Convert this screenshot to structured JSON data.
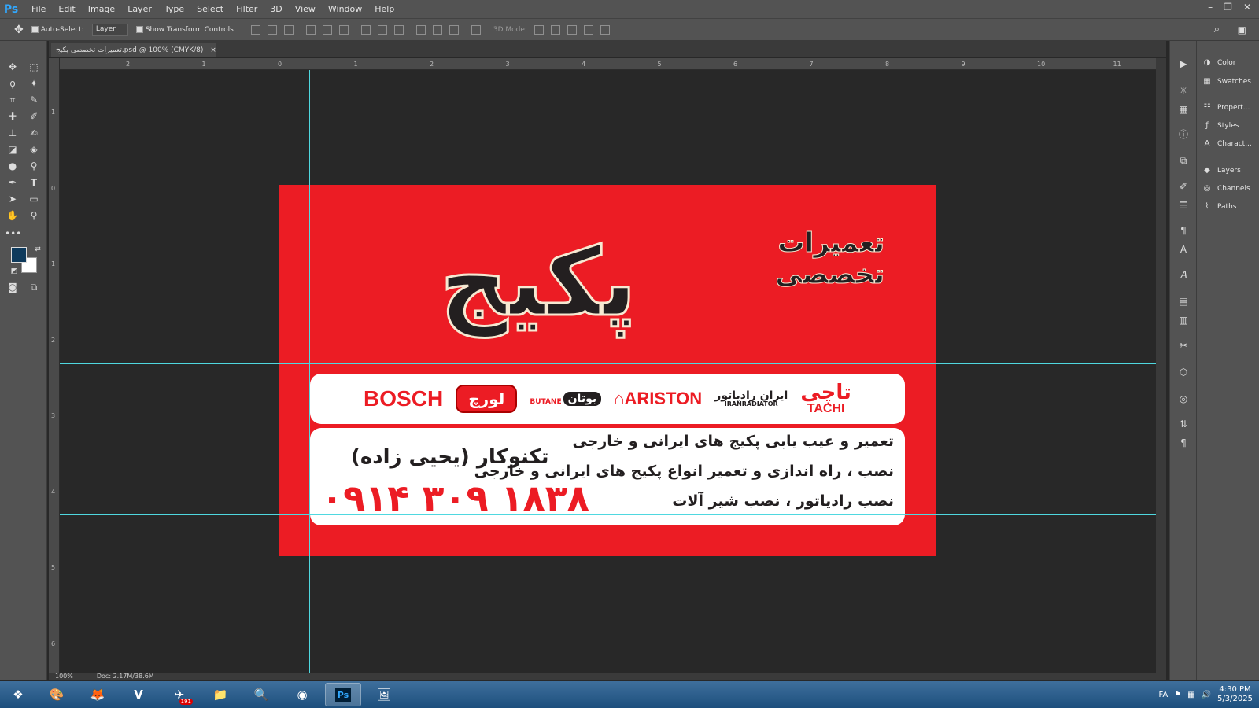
{
  "app": {
    "logo": "Ps",
    "menu": [
      "File",
      "Edit",
      "Image",
      "Layer",
      "Type",
      "Select",
      "Filter",
      "3D",
      "View",
      "Window",
      "Help"
    ],
    "window_controls": [
      "–",
      "❐",
      "✕"
    ]
  },
  "options": {
    "auto_select_label": "Auto-Select:",
    "auto_select_value": "Layer",
    "show_transform_label": "Show Transform Controls",
    "mode_3d_label": "3D Mode:"
  },
  "document": {
    "tab_title": "تعمیرات تخصصی پکیج.psd @ 100% (CMYK/8)",
    "close": "×",
    "zoom": "100%",
    "doc_info": "Doc: 2.17M/38.6M"
  },
  "rulers": {
    "h": [
      "2",
      "1",
      "0",
      "1",
      "2",
      "3",
      "4",
      "5",
      "6",
      "7",
      "8",
      "9",
      "10",
      "11"
    ],
    "v": [
      "1",
      "0",
      "1",
      "2",
      "3",
      "4",
      "5",
      "6"
    ]
  },
  "panels": [
    {
      "label": "Color",
      "icon": "color-icon"
    },
    {
      "label": "Swatches",
      "icon": "swatches-icon"
    },
    {
      "label": "Propert...",
      "icon": "properties-icon"
    },
    {
      "label": "Styles",
      "icon": "styles-icon"
    },
    {
      "label": "Charact...",
      "icon": "character-icon"
    },
    {
      "label": "Layers",
      "icon": "layers-icon"
    },
    {
      "label": "Channels",
      "icon": "channels-icon"
    },
    {
      "label": "Paths",
      "icon": "paths-icon"
    }
  ],
  "colors": {
    "foreground": "#0e3a5c",
    "background": "#ffffff",
    "card_red": "#ec1c24",
    "card_text": "#231f20"
  },
  "card": {
    "subtitle": "تعمیرات تخصصی",
    "title": "پکیج",
    "brands": {
      "bosch": "BOSCH",
      "lorch": "لورچ",
      "butane_latin": "BUTANE",
      "butane": "بوتان",
      "ariston": "ARISTON",
      "iran_radiator": "ایران رادیاتور",
      "iran_radiator_latin": "IRANRADIATOR",
      "tachi_fa": "تاچی",
      "tachi": "TACHI"
    },
    "services": [
      "تعمیر و عیب یابی پکیج های ایرانی و خارجی",
      "نصب ، راه اندازی و تعمیر انواع پکیج های ایرانی و خارجی",
      "نصب رادیاتور ، نصب شیر آلات"
    ],
    "technician": "تکنوکار (یحیی زاده)",
    "phone": "۰۹۱۴ ۳۰۹ ۱۸۳۸"
  },
  "taskbar": {
    "telegram_badge": "191",
    "language": "FA",
    "time": "4:30 PM",
    "date": "5/3/2025"
  }
}
